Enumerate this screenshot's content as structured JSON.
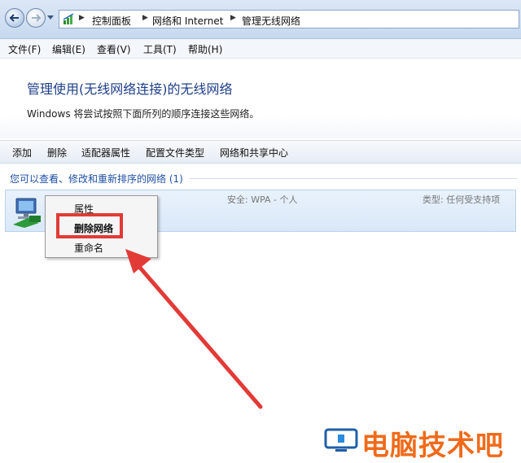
{
  "window": {
    "breadcrumbs": [
      "控制面板",
      "网络和 Internet",
      "管理无线网络"
    ]
  },
  "menu": [
    "文件(F)",
    "编辑(E)",
    "查看(V)",
    "工具(T)",
    "帮助(H)"
  ],
  "header": {
    "title": "管理使用(无线网络连接)的无线网络",
    "subtitle": "Windows 将尝试按照下面所列的顺序连接这些网络。"
  },
  "toolbar": [
    "添加",
    "删除",
    "适配器属性",
    "配置文件类型",
    "网络和共享中心"
  ],
  "group": {
    "label": "您可以查看、修改和重新排序的网络 (1)"
  },
  "network": {
    "security": "安全: WPA - 个人",
    "type": "类型: 任何受支持项"
  },
  "context_menu": {
    "items": [
      "属性",
      "删除网络",
      "重命名"
    ],
    "highlighted": "删除网络"
  },
  "watermark": {
    "text": "电脑技术吧"
  },
  "colors": {
    "title": "#1e3f8a",
    "group_label": "#1f4fa5",
    "highlight": "#e23a36",
    "arrow": "#e23a36",
    "watermark": "#f06a1a"
  }
}
